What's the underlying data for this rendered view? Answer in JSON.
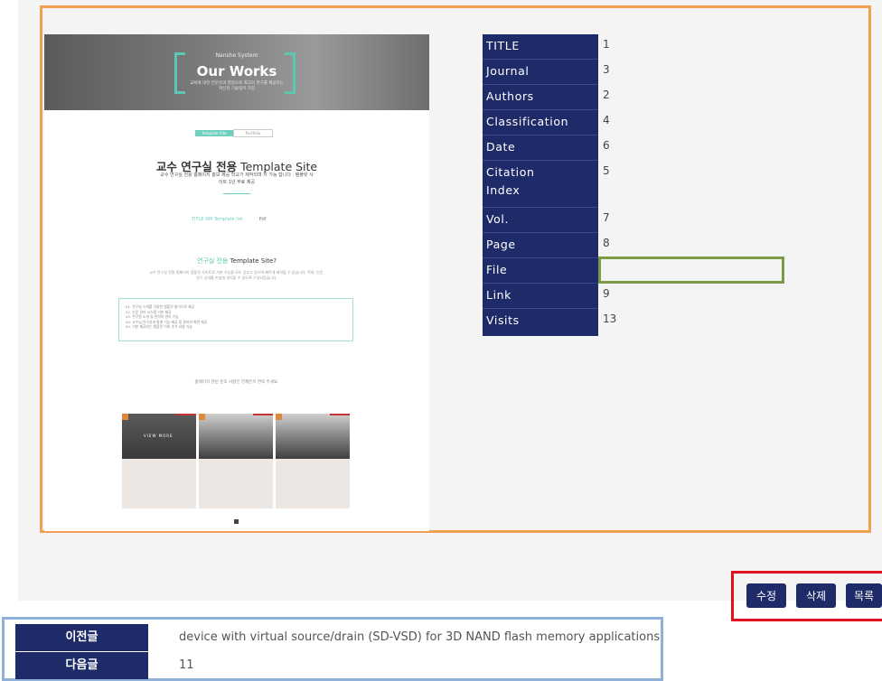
{
  "preview": {
    "hero_subtitle": "Nanshe System",
    "hero_title": "Our Works",
    "hero_description": "교육에 대한 전문성과 열정으로 최고의 연구를 제공하는 혁신적 기술팀이 가장",
    "tabs": [
      "Template Site",
      "Portfolio"
    ],
    "site_title_bold": "교수 연구실 전용",
    "site_title_rest": "Template Site",
    "site_description": "교수 연구실 전용 홈페이지 홍보 제공 학교가 제작되며 저 가능 합니다 · 템플릿 사이트 1년 무료 제공",
    "meta_left": "TITLE NM Template list",
    "meta_right": "Pdf",
    "section_title_colored": "연구실 전용",
    "section_title_rest": "Template Site?",
    "section_description": "교수 연구실 전용 홈페이지 템플릿 사이트로 기본 기능을 모두 갖추고 있으며 빠르게 제작할 수 있습니다. 학회, 논문, 연구 성과를 손쉽게 관리할 수 있도록 구성되었습니다.",
    "info_lines": [
      "01. 연구실 소개를 다양한 템플릿 형식으로 제공",
      "02. 논문 관리 시스템 기본 제공",
      "03. 연구원 소개 및 연락처 관리 기능",
      "04. 교수님 연구성과 통계 기능 제공 및 관리자 화면 제공",
      "05. 기본 제공되는 템플릿 이외 추가 요청 가능"
    ],
    "contact_text": "홈페이지 관련 문의 사항은 언제든지 연락 주세요.",
    "card_label": "VIEW MORE"
  },
  "fields": [
    {
      "label": "TITLE",
      "value": "1"
    },
    {
      "label": "Journal",
      "value": "3"
    },
    {
      "label": "Authors",
      "value": "2"
    },
    {
      "label": "Classification",
      "value": "4"
    },
    {
      "label": "Date",
      "value": "6"
    },
    {
      "label": "Citation Index",
      "value": "5"
    },
    {
      "label": "Vol.",
      "value": "7"
    },
    {
      "label": "Page",
      "value": "8"
    },
    {
      "label": "File",
      "value": ""
    },
    {
      "label": "Link",
      "value": "9"
    },
    {
      "label": "Visits",
      "value": "13"
    }
  ],
  "buttons": {
    "edit": "수정",
    "delete": "삭제",
    "list": "목록"
  },
  "nav": {
    "prev_label": "이전글",
    "prev_value": "device with virtual source/drain (SD-VSD) for 3D NAND flash memory applications",
    "next_label": "다음글",
    "next_value": "11"
  },
  "colors": {
    "navy": "#1e2b68",
    "teal": "#6fd0c0",
    "orange_frame": "#f0a050",
    "red_frame": "#e2111e",
    "green_frame": "#7b9a45",
    "blue_frame": "#8fb0d8"
  }
}
